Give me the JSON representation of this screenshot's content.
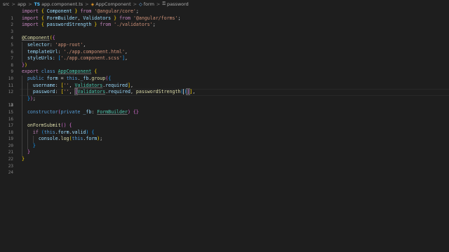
{
  "breadcrumb": {
    "items": [
      "src",
      "app",
      "app.component.ts",
      "AppComponent",
      "form",
      "password"
    ],
    "separator": ">"
  },
  "editor": {
    "active_line": 13,
    "line_numbers": [
      "1",
      "2",
      "3",
      "4",
      "5",
      "6",
      "7",
      "8",
      "9",
      "10",
      "11",
      "12",
      "13",
      "14",
      "15",
      "16",
      "17",
      "18",
      "19",
      "20",
      "21",
      "22",
      "23",
      "24"
    ],
    "theme_background": "#1e1e1e",
    "tokens": {
      "import": "import",
      "from": "from",
      "component": "Component",
      "angular_core": "'@angular/core'",
      "formbuilder": "FormBuilder",
      "validators": "Validators",
      "angular_forms": "'@angular/forms'",
      "passwordStrength": "passwordStrength",
      "validators_path": "'./validators'",
      "decorator": "@Component",
      "selector": "selector",
      "app_root": "'app-root'",
      "templateUrl": "templateUrl",
      "html_path": "'./app.component.html'",
      "styleUrls": "styleUrls",
      "scss_path": "'./app.component.scss'",
      "export": "export",
      "class": "class",
      "appcomponent": "AppComponent",
      "public": "public",
      "form": "form",
      "this": "this",
      "fb": "_fb",
      "group": "group",
      "username": "username",
      "empty_str": "''",
      "required": "required",
      "password": "password",
      "constructor": "constructor",
      "private": "private",
      "onFormSubmit": "onFormSubmit",
      "if": "if",
      "valid": "valid",
      "console": "console",
      "log": "log"
    }
  }
}
